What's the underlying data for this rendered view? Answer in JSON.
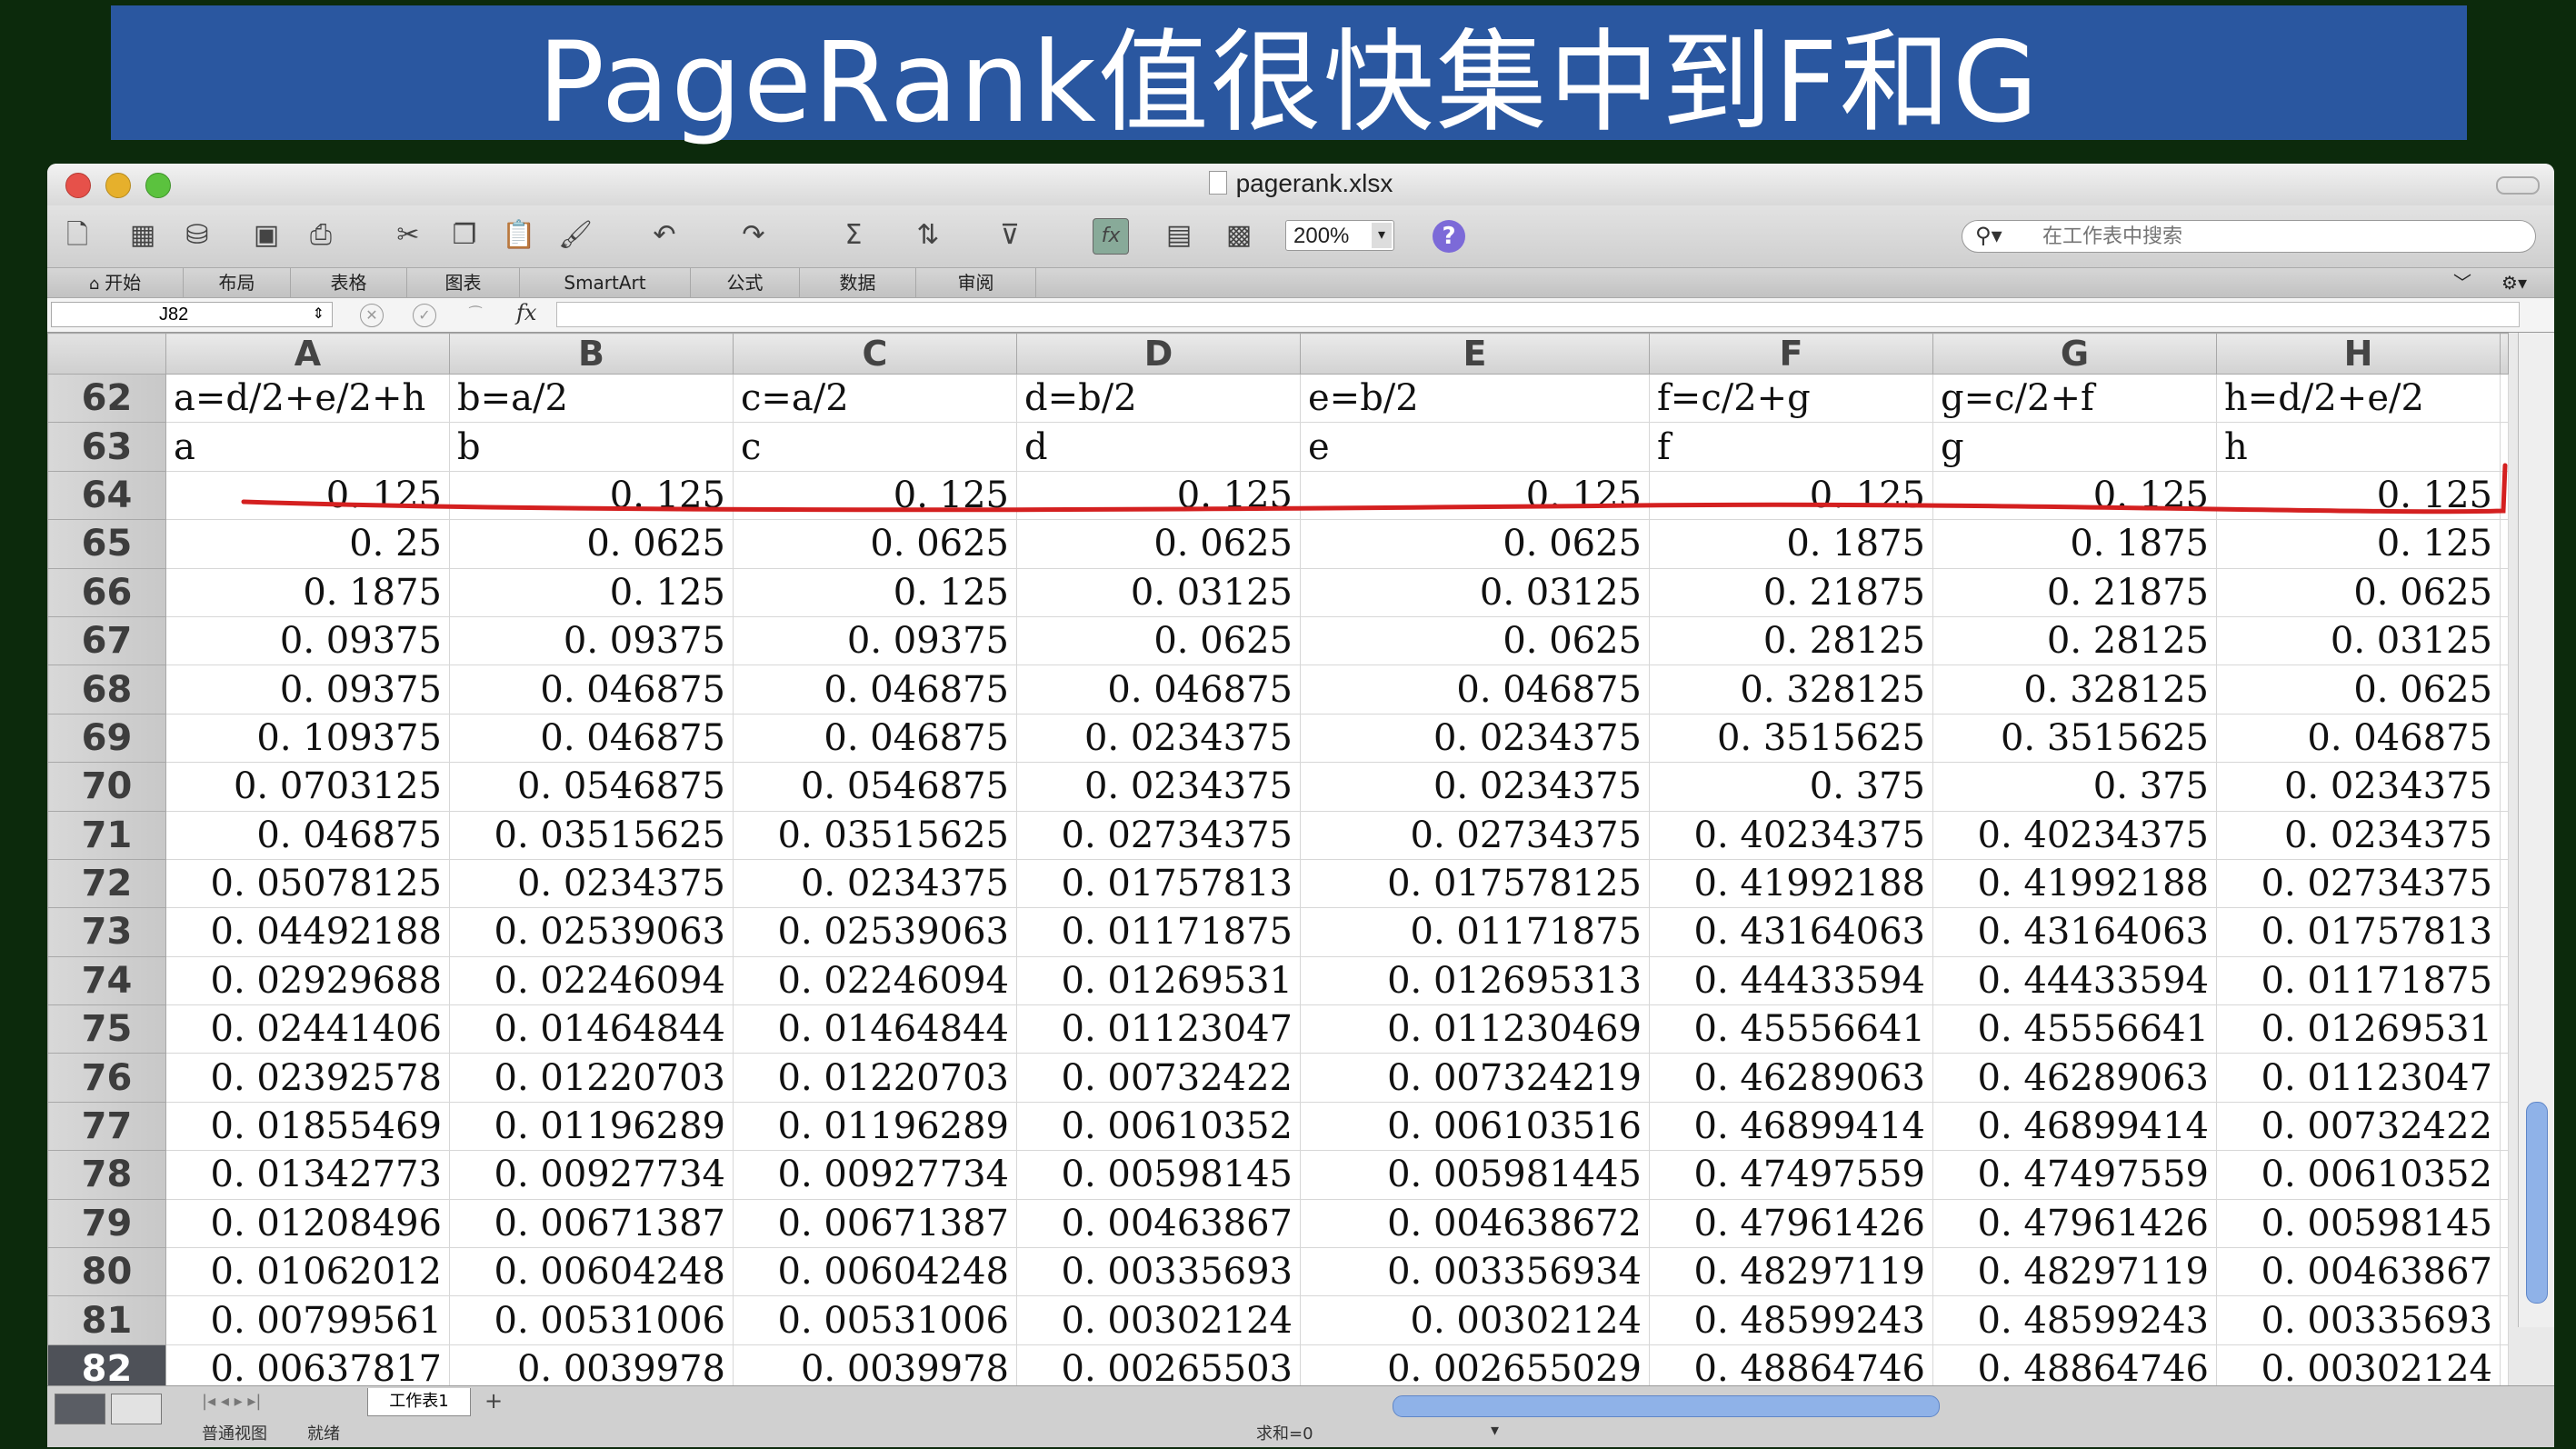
{
  "banner": {
    "title": "PageRank值很快集中到F和G"
  },
  "window": {
    "title": "pagerank.xlsx"
  },
  "toolbar": {
    "zoom": "200%",
    "help": "?"
  },
  "search": {
    "placeholder": "在工作表中搜索"
  },
  "ribbon": {
    "tabs": [
      "开始",
      "布局",
      "表格",
      "图表",
      "SmartArt",
      "公式",
      "数据",
      "审阅"
    ]
  },
  "formula_bar": {
    "cell_ref": "J82",
    "fx": "fx",
    "value": ""
  },
  "columns": [
    "A",
    "B",
    "C",
    "D",
    "E",
    "F",
    "G",
    "H"
  ],
  "rows": [
    {
      "n": "62",
      "cells": [
        "a=d/2+e/2+h",
        "b=a/2",
        "c=a/2",
        "d=b/2",
        "e=b/2",
        "f=c/2+g",
        "g=c/2+f",
        "h=d/2+e/2"
      ]
    },
    {
      "n": "63",
      "cells": [
        "a",
        "b",
        "c",
        "d",
        "e",
        "f",
        "g",
        "h"
      ]
    },
    {
      "n": "64",
      "cells": [
        "0. 125",
        "0. 125",
        "0. 125",
        "0. 125",
        "0. 125",
        "0. 125",
        "0. 125",
        "0. 125"
      ]
    },
    {
      "n": "65",
      "cells": [
        "0. 25",
        "0. 0625",
        "0. 0625",
        "0. 0625",
        "0. 0625",
        "0. 1875",
        "0. 1875",
        "0. 125"
      ]
    },
    {
      "n": "66",
      "cells": [
        "0. 1875",
        "0. 125",
        "0. 125",
        "0. 03125",
        "0. 03125",
        "0. 21875",
        "0. 21875",
        "0. 0625"
      ]
    },
    {
      "n": "67",
      "cells": [
        "0. 09375",
        "0. 09375",
        "0. 09375",
        "0. 0625",
        "0. 0625",
        "0. 28125",
        "0. 28125",
        "0. 03125"
      ]
    },
    {
      "n": "68",
      "cells": [
        "0. 09375",
        "0. 046875",
        "0. 046875",
        "0. 046875",
        "0. 046875",
        "0. 328125",
        "0. 328125",
        "0. 0625"
      ]
    },
    {
      "n": "69",
      "cells": [
        "0. 109375",
        "0. 046875",
        "0. 046875",
        "0. 0234375",
        "0. 0234375",
        "0. 3515625",
        "0. 3515625",
        "0. 046875"
      ]
    },
    {
      "n": "70",
      "cells": [
        "0. 0703125",
        "0. 0546875",
        "0. 0546875",
        "0. 0234375",
        "0. 0234375",
        "0. 375",
        "0. 375",
        "0. 0234375"
      ]
    },
    {
      "n": "71",
      "cells": [
        "0. 046875",
        "0. 03515625",
        "0. 03515625",
        "0. 02734375",
        "0. 02734375",
        "0. 40234375",
        "0. 40234375",
        "0. 0234375"
      ]
    },
    {
      "n": "72",
      "cells": [
        "0. 05078125",
        "0. 0234375",
        "0. 0234375",
        "0. 01757813",
        "0. 017578125",
        "0. 41992188",
        "0. 41992188",
        "0. 02734375"
      ]
    },
    {
      "n": "73",
      "cells": [
        "0. 04492188",
        "0. 02539063",
        "0. 02539063",
        "0. 01171875",
        "0. 01171875",
        "0. 43164063",
        "0. 43164063",
        "0. 01757813"
      ]
    },
    {
      "n": "74",
      "cells": [
        "0. 02929688",
        "0. 02246094",
        "0. 02246094",
        "0. 01269531",
        "0. 012695313",
        "0. 44433594",
        "0. 44433594",
        "0. 01171875"
      ]
    },
    {
      "n": "75",
      "cells": [
        "0. 02441406",
        "0. 01464844",
        "0. 01464844",
        "0. 01123047",
        "0. 011230469",
        "0. 45556641",
        "0. 45556641",
        "0. 01269531"
      ]
    },
    {
      "n": "76",
      "cells": [
        "0. 02392578",
        "0. 01220703",
        "0. 01220703",
        "0. 00732422",
        "0. 007324219",
        "0. 46289063",
        "0. 46289063",
        "0. 01123047"
      ]
    },
    {
      "n": "77",
      "cells": [
        "0. 01855469",
        "0. 01196289",
        "0. 01196289",
        "0. 00610352",
        "0. 006103516",
        "0. 46899414",
        "0. 46899414",
        "0. 00732422"
      ]
    },
    {
      "n": "78",
      "cells": [
        "0. 01342773",
        "0. 00927734",
        "0. 00927734",
        "0. 00598145",
        "0. 005981445",
        "0. 47497559",
        "0. 47497559",
        "0. 00610352"
      ]
    },
    {
      "n": "79",
      "cells": [
        "0. 01208496",
        "0. 00671387",
        "0. 00671387",
        "0. 00463867",
        "0. 004638672",
        "0. 47961426",
        "0. 47961426",
        "0. 00598145"
      ]
    },
    {
      "n": "80",
      "cells": [
        "0. 01062012",
        "0. 00604248",
        "0. 00604248",
        "0. 00335693",
        "0. 003356934",
        "0. 48297119",
        "0. 48297119",
        "0. 00463867"
      ]
    },
    {
      "n": "81",
      "cells": [
        "0. 00799561",
        "0. 00531006",
        "0. 00531006",
        "0. 00302124",
        "0. 00302124",
        "0. 48599243",
        "0. 48599243",
        "0. 00335693"
      ]
    },
    {
      "n": "82",
      "cells": [
        "0. 00637817",
        "0. 0039978",
        "0. 0039978",
        "0. 00265503",
        "0. 002655029",
        "0. 48864746",
        "0. 48864746",
        "0. 00302124"
      ]
    }
  ],
  "selected_row": "82",
  "sheet_tab": "工作表1",
  "status_bar": {
    "view": "普通视图",
    "ready": "就绪",
    "sum": "求和=0"
  },
  "colors": {
    "banner": "#2a57a0",
    "annotation": "#d42020",
    "selected_row_header": "#4e5158"
  }
}
